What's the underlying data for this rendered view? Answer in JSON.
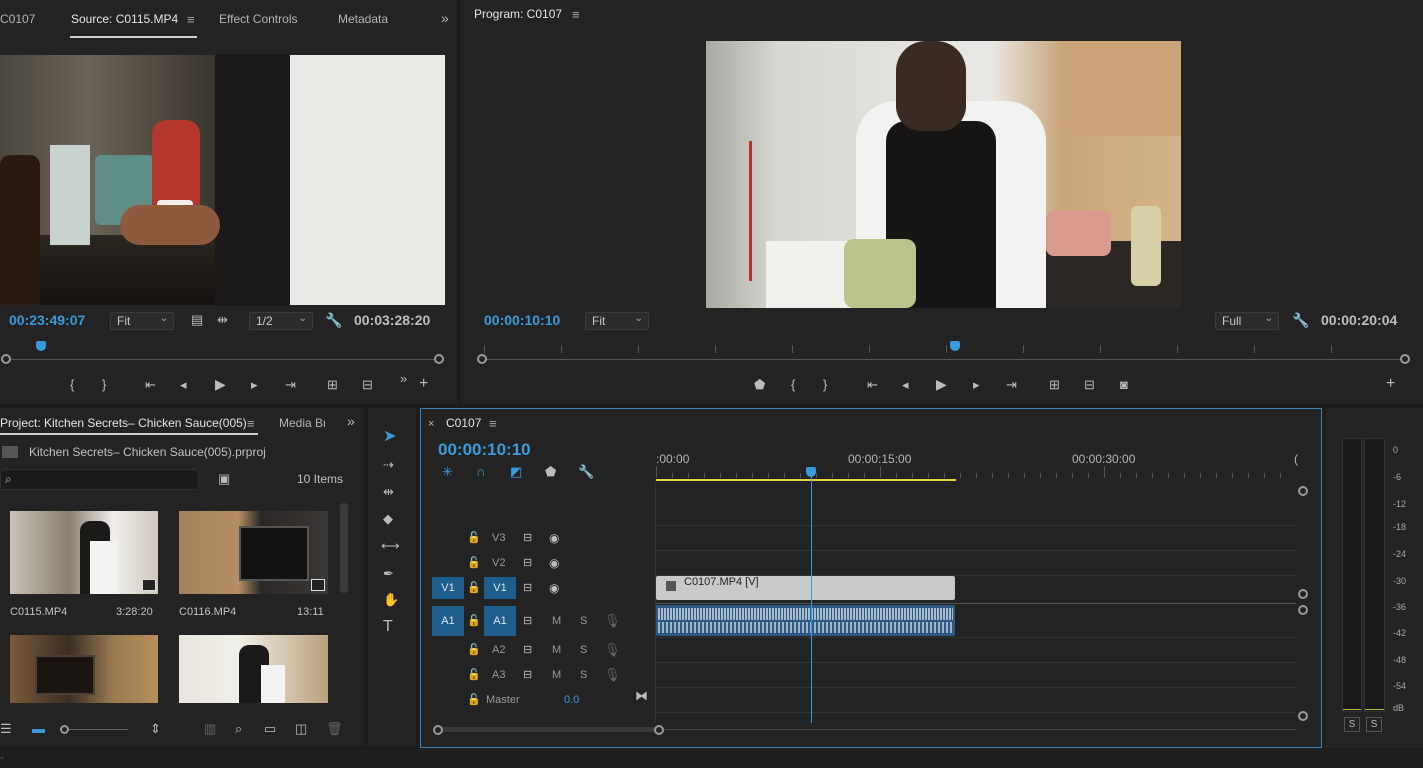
{
  "source_panel": {
    "tab_clip": "C0107",
    "tab_source": "Source: C0115.MP4",
    "tab_effects": "Effect Controls",
    "tab_metadata": "Metadata",
    "timecode_in": "00:23:49:07",
    "fit": "Fit",
    "resolution": "1/2",
    "duration": "00:03:28:20"
  },
  "program_panel": {
    "title": "Program: C0107",
    "timecode": "00:00:10:10",
    "fit": "Fit",
    "quality": "Full",
    "duration": "00:00:20:04"
  },
  "project_panel": {
    "tab_project": "Project: Kitchen Secrets– Chicken Sauce(005)",
    "tab_media": "Media Br",
    "file_name": "Kitchen Secrets– Chicken Sauce(005).prproj",
    "search_placeholder": "",
    "item_count": "10 Items",
    "items": [
      {
        "name": "C0115.MP4",
        "duration": "3:28:20"
      },
      {
        "name": "C0116.MP4",
        "duration": "13:11"
      },
      {
        "name": "",
        "duration": ""
      },
      {
        "name": "",
        "duration": ""
      }
    ]
  },
  "timeline": {
    "sequence": "C0107",
    "timecode": "00:00:10:10",
    "ruler": [
      ":00:00",
      "00:00:15:00",
      "00:00:30:00"
    ],
    "tracks": {
      "v3": "V3",
      "v2": "V2",
      "v1": "V1",
      "v1_src": "V1",
      "a1": "A1",
      "a1_src": "A1",
      "a2": "A2",
      "a3": "A3",
      "mute": "M",
      "solo": "S",
      "master": "Master",
      "master_value": "0.0"
    },
    "video_clip": "C0107.MP4 [V]",
    "playhead_seconds": 10.4
  },
  "audio_meter": {
    "scale": [
      "0",
      "-6",
      "-12",
      "-18",
      "-24",
      "-30",
      "-36",
      "-42",
      "-48",
      "-54",
      "dB"
    ],
    "solo_left": "S",
    "solo_right": "S"
  },
  "colors": {
    "accent": "#3a9bdc",
    "track_target": "#1f5d8c",
    "audio_clip": "#2c5a85",
    "work_area": "#e5d33b"
  }
}
